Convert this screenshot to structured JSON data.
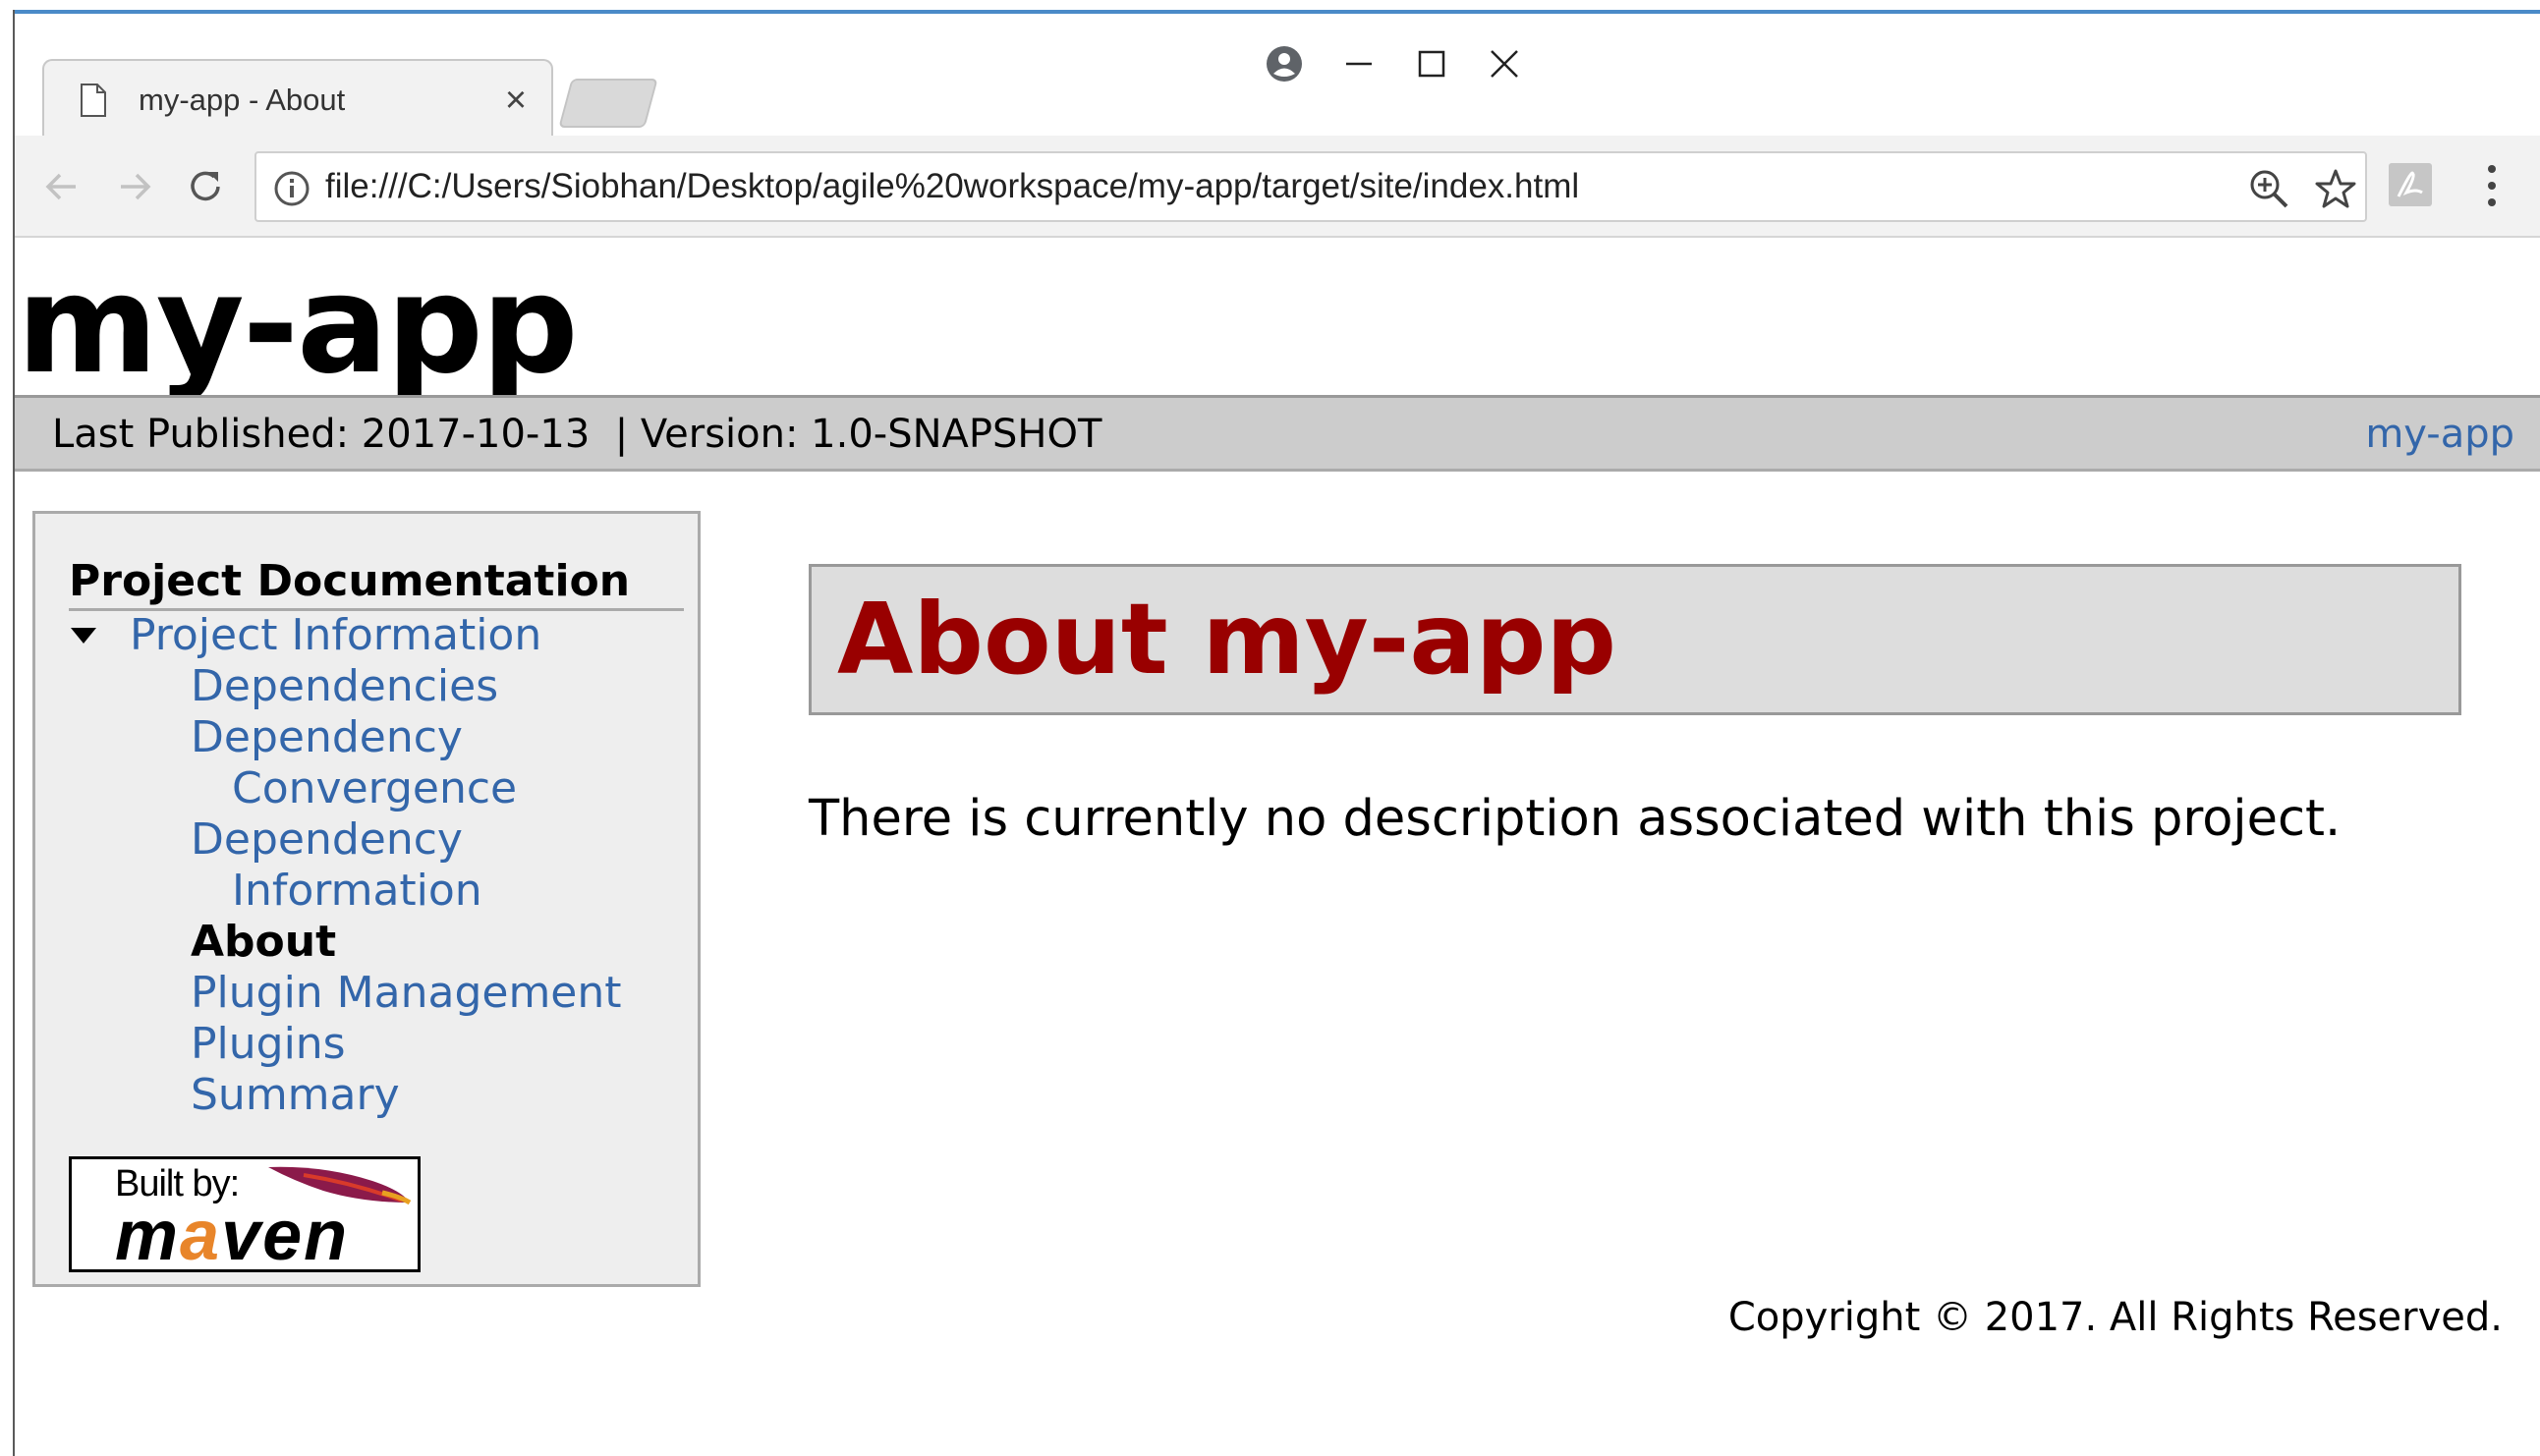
{
  "browser": {
    "tab_title": "my-app - About",
    "tab_close": "×",
    "url": "file:///C:/Users/Siobhan/Desktop/agile%20workspace/my-app/target/site/index.html"
  },
  "site": {
    "title": "my-app",
    "last_published": "Last Published: 2017-10-13  | Version: 1.0-SNAPSHOT",
    "breadcrumb_link": "my-app"
  },
  "nav": {
    "header": "Project Documentation",
    "project_information": "Project Information",
    "items": [
      {
        "label": "Dependencies",
        "active": false
      },
      {
        "label": "Dependency",
        "active": false
      },
      {
        "label": "Convergence",
        "active": false
      },
      {
        "label": "Dependency",
        "active": false
      },
      {
        "label": "Information",
        "active": false
      },
      {
        "label": "About",
        "active": true
      },
      {
        "label": "Plugin Management",
        "active": false
      },
      {
        "label": "Plugins",
        "active": false
      },
      {
        "label": "Summary",
        "active": false
      }
    ]
  },
  "badge": {
    "built_by": "Built by:",
    "maven_before": "m",
    "maven_accent": "a",
    "maven_after": "ven"
  },
  "content": {
    "heading": "About my-app",
    "description": "There is currently no description associated with this project."
  },
  "footer": {
    "copyright": "Copyright © 2017. All Rights Reserved."
  },
  "colors": {
    "link": "#3366aa",
    "heading": "#990000",
    "breadcrumb_bg": "#cccccc",
    "sidebar_bg": "#eeeeee"
  }
}
